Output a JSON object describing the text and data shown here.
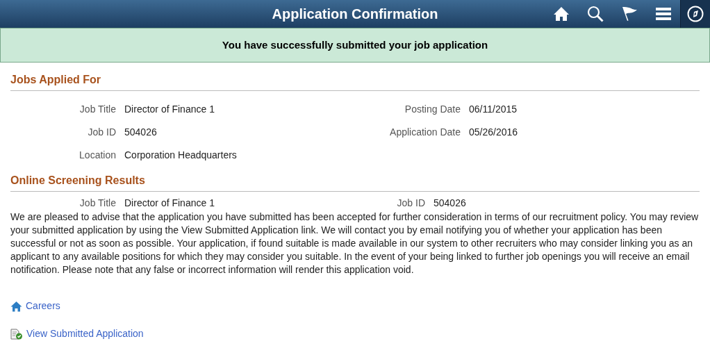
{
  "header": {
    "title": "Application Confirmation"
  },
  "banner": {
    "message": "You have successfully submitted your job application"
  },
  "jobs_applied_for": {
    "title": "Jobs Applied For",
    "left": [
      {
        "label": "Job Title",
        "value": "Director of Finance 1"
      },
      {
        "label": "Job ID",
        "value": "504026"
      },
      {
        "label": "Location",
        "value": "Corporation Headquarters"
      }
    ],
    "right": [
      {
        "label": "Posting Date",
        "value": "06/11/2015"
      },
      {
        "label": "Application Date",
        "value": "05/26/2016"
      }
    ]
  },
  "screening": {
    "title": "Online Screening Results",
    "left": [
      {
        "label": "Job Title",
        "value": "Director of Finance 1"
      }
    ],
    "right": [
      {
        "label": "Job ID",
        "value": "504026"
      }
    ],
    "message": "We are pleased to advise that the application you have submitted has been accepted for further consideration in terms of our recruitment policy. You may review your submitted application by using the View Submitted Application link. We will contact you by email notifying you of whether your application has been successful or not as soon as possible. Your application, if found suitable is made available in our system to other recruiters who may consider linking you as an applicant to any available positions for which they may consider you suitable. In the event of your being linked to further job openings you will receive an email notification. Please note that any false or incorrect information will render this application void."
  },
  "links": [
    {
      "kind": "home",
      "label": "Careers"
    },
    {
      "kind": "document",
      "label": "View Submitted Application"
    }
  ]
}
